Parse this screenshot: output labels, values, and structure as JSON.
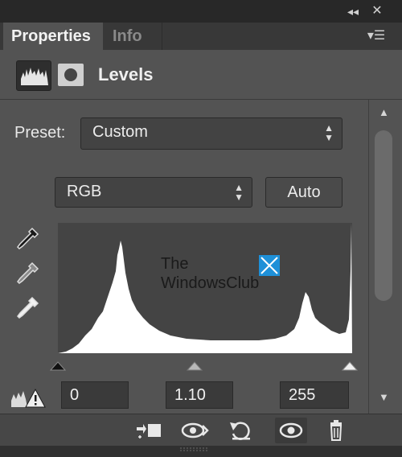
{
  "panel": {
    "tabs": [
      {
        "label": "Properties",
        "active": true
      },
      {
        "label": "Info",
        "active": false
      }
    ],
    "collapse_icon": "double-chevron-left-icon",
    "close_icon": "close-icon",
    "menu_icon": "panel-menu-icon"
  },
  "header": {
    "title": "Levels",
    "levels_icon": "levels-adjustment-icon",
    "mask_icon": "layer-mask-icon"
  },
  "preset": {
    "label": "Preset:",
    "value": "Custom"
  },
  "channel": {
    "value": "RGB"
  },
  "auto_button": {
    "label": "Auto"
  },
  "eyedroppers": [
    "black-point-eyedropper-icon",
    "gray-point-eyedropper-icon",
    "white-point-eyedropper-icon"
  ],
  "watermark": {
    "line1": "The",
    "line2": "WindowsClub"
  },
  "inputs": {
    "black": "0",
    "gamma": "1.10",
    "white": "255"
  },
  "bottom_toolbar": [
    "clip-to-layer-icon",
    "view-previous-state-icon",
    "reset-icon",
    "toggle-visibility-icon",
    "delete-icon"
  ],
  "colors": {
    "panel_bg": "#535353",
    "histogram_bg": "#444444",
    "histogram_fill": "#ffffff",
    "watermark_blue": "#1e90d8"
  }
}
